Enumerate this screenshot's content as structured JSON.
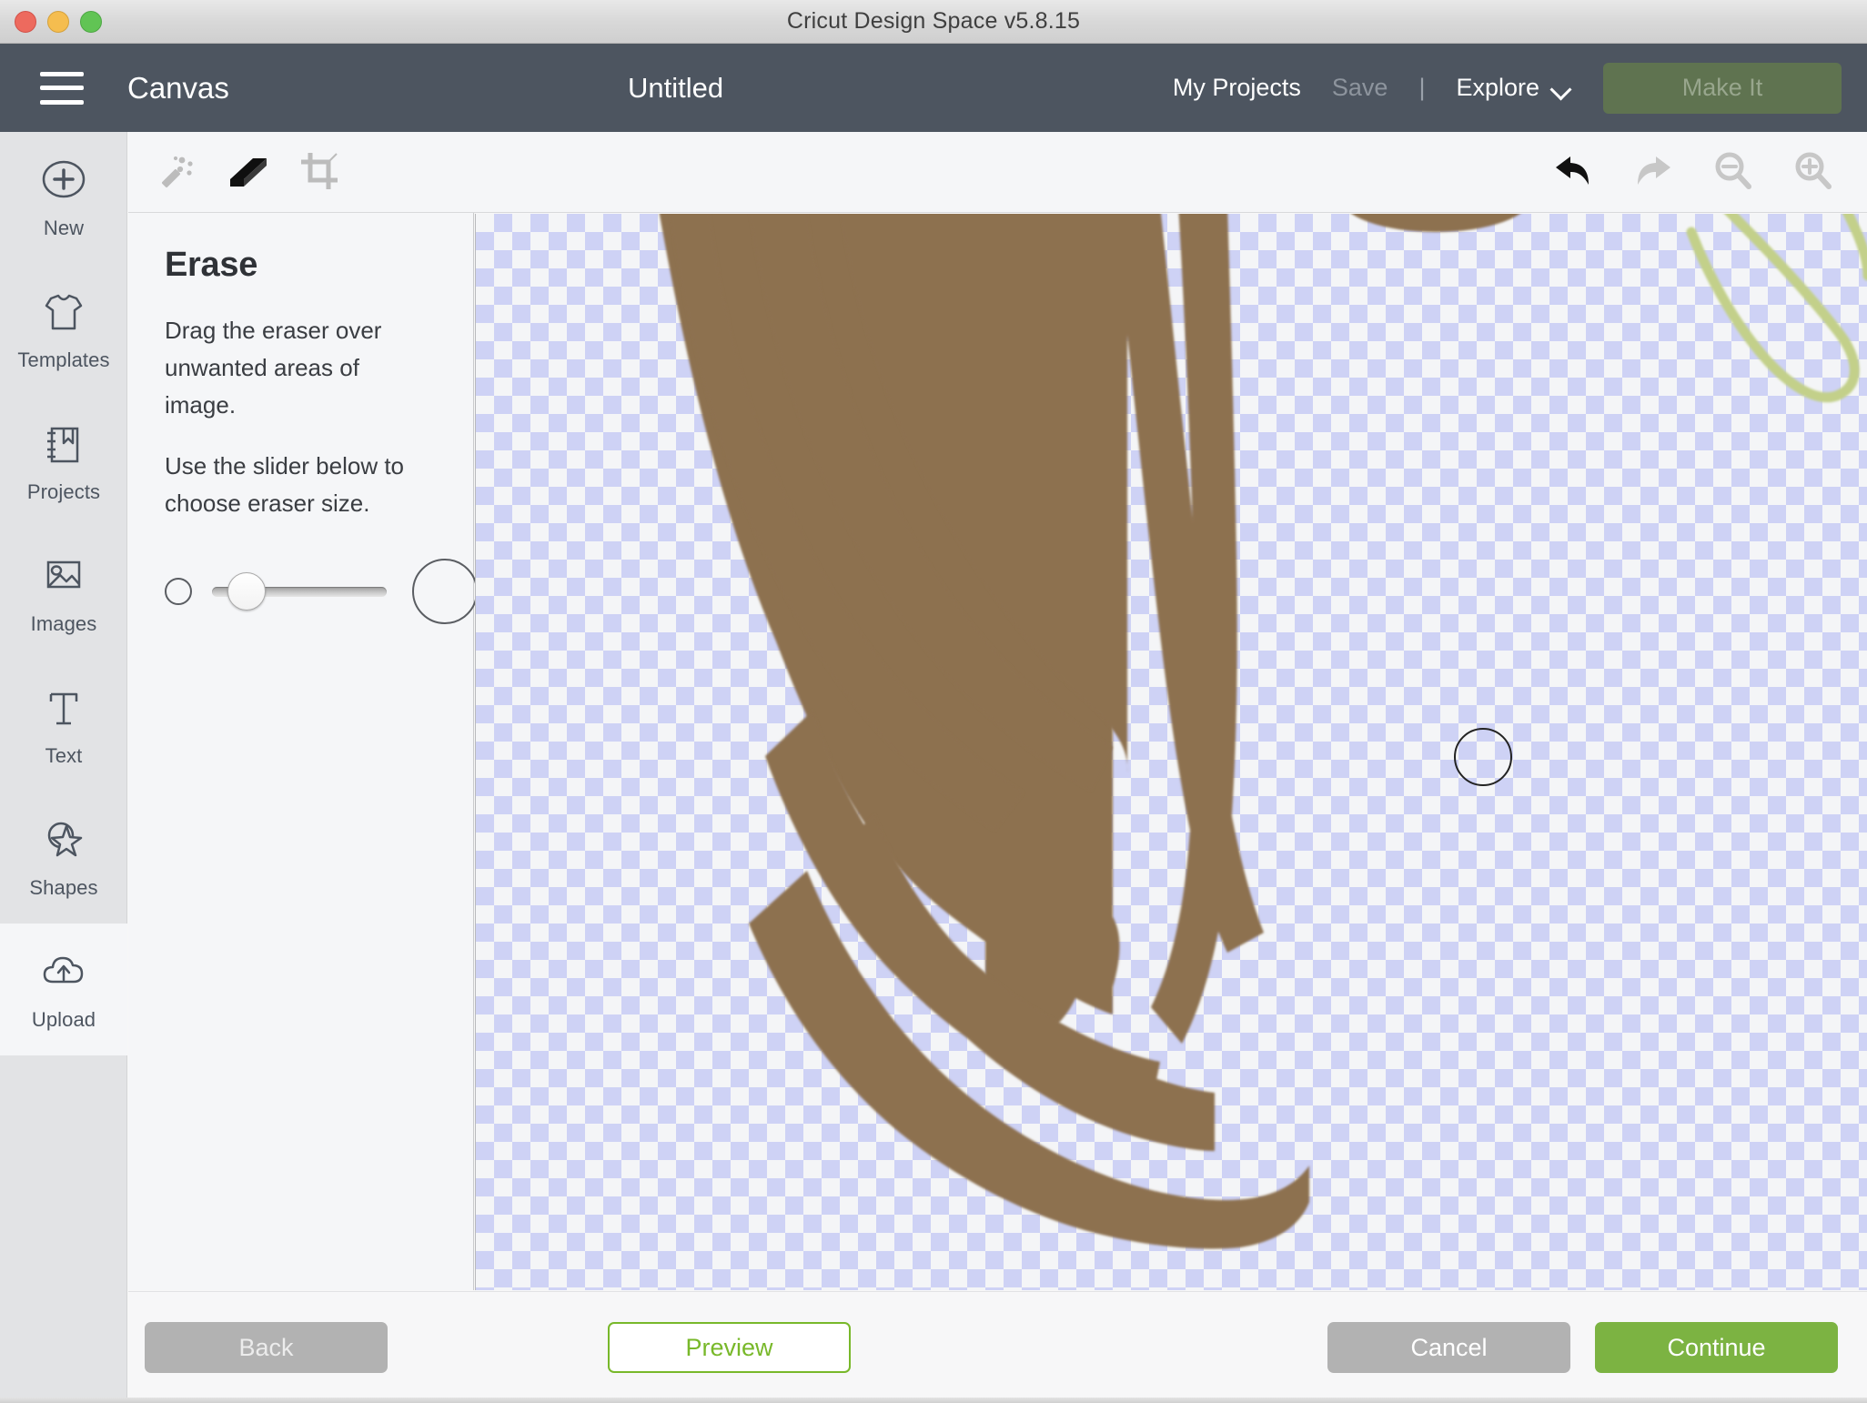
{
  "window": {
    "title": "Cricut Design Space  v5.8.15",
    "traffic_lights": [
      "close-button",
      "minimize-button",
      "maximize-button"
    ]
  },
  "header": {
    "menu_icon": "hamburger-icon",
    "canvas_label": "Canvas",
    "project_title": "Untitled",
    "my_projects_label": "My Projects",
    "save_label": "Save",
    "separator": "|",
    "explore_label": "Explore",
    "explore_chevron": "chevron-down-icon",
    "make_it_label": "Make It",
    "colors": {
      "header_bg": "#4d5560",
      "make_it_bg": "#5f7350",
      "make_it_text": "#98a68d"
    }
  },
  "sidebar": {
    "items": [
      {
        "label": "New",
        "icon": "plus-circle-icon",
        "active": false
      },
      {
        "label": "Templates",
        "icon": "tshirt-icon",
        "active": false
      },
      {
        "label": "Projects",
        "icon": "notebook-bookmark-icon",
        "active": false
      },
      {
        "label": "Images",
        "icon": "picture-icon",
        "active": false
      },
      {
        "label": "Text",
        "icon": "text-t-icon",
        "active": false
      },
      {
        "label": "Shapes",
        "icon": "circle-star-icon",
        "active": false
      },
      {
        "label": "Upload",
        "icon": "cloud-upload-icon",
        "active": true
      }
    ]
  },
  "toolbar": {
    "left_tools": [
      {
        "name": "magic-wand-tool",
        "icon": "magic-wand-icon",
        "enabled": false
      },
      {
        "name": "eraser-tool",
        "icon": "eraser-icon",
        "enabled": true
      },
      {
        "name": "crop-tool",
        "icon": "crop-icon",
        "enabled": false
      }
    ],
    "right_tools": [
      {
        "name": "undo-button",
        "icon": "undo-arrow-icon",
        "enabled": true
      },
      {
        "name": "redo-button",
        "icon": "redo-arrow-icon",
        "enabled": false
      },
      {
        "name": "zoom-out-button",
        "icon": "magnifier-minus-icon",
        "enabled": false
      },
      {
        "name": "zoom-in-button",
        "icon": "magnifier-plus-icon",
        "enabled": false
      }
    ]
  },
  "panel": {
    "title": "Erase",
    "paragraph_1": "Drag the eraser over unwanted areas of image.",
    "paragraph_2": "Use the slider below to choose eraser size.",
    "slider": {
      "small_icon": "small-circle-icon",
      "large_icon": "large-circle-icon",
      "value_percent": 20
    }
  },
  "canvas": {
    "transparency_checker_colors": [
      "#ced2f5",
      "#f4f5f7"
    ],
    "artwork_color": "#8d7150",
    "leaf_color": "#c3d08a",
    "eraser_cursor": "eraser-cursor-circle"
  },
  "footer": {
    "back_label": "Back",
    "preview_label": "Preview",
    "cancel_label": "Cancel",
    "continue_label": "Continue",
    "colors": {
      "disabled_gray": "#b2b2b2",
      "accent_green": "#7cb342",
      "preview_border_green": "#78b82a"
    }
  }
}
